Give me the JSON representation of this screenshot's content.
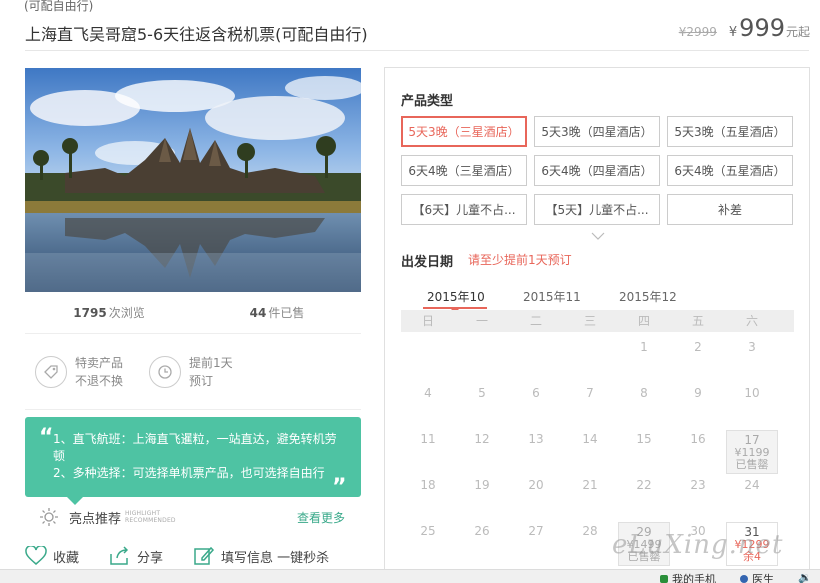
{
  "product": {
    "subtitle_cut": "(可配自由行)",
    "title": "上海直飞吴哥窟5-6天往返含税机票(可配自由行)",
    "original_price": "¥2999",
    "currency": "¥",
    "price": "999",
    "price_suffix": "元起"
  },
  "stats": {
    "views": "1795",
    "views_label": "次浏览",
    "sold": "44",
    "sold_label": "件已售"
  },
  "features": [
    {
      "icon": "tag-icon",
      "line1": "特卖产品",
      "line2": "不退不换"
    },
    {
      "icon": "clock-icon",
      "line1": "提前1天",
      "line2": "预订"
    }
  ],
  "highlights": {
    "quote_left": "“",
    "quote_right": "„",
    "text1": "1、直飞航班：上海直飞暹粒，一站直达，避免转机劳顿",
    "text2": "2、多种选择：可选择单机票产品，也可选择自由行",
    "label": "亮点推荐",
    "label_en1": "HIGHLIGHT",
    "label_en2": "RECOMMENDED",
    "more": "查看更多"
  },
  "actions": {
    "favorite": "收藏",
    "share": "分享",
    "quick_order": "填写信息 一键秒杀"
  },
  "product_type": {
    "title": "产品类型",
    "options": [
      "5天3晚（三星酒店）",
      "5天3晚（四星酒店）",
      "5天3晚（五星酒店）",
      "6天4晚（三星酒店）",
      "6天4晚（四星酒店）",
      "6天4晚（五星酒店）",
      "【6天】儿童不占...",
      "【5天】儿童不占...",
      "补差"
    ],
    "selected_index": 0
  },
  "departure": {
    "title": "出发日期",
    "notice": "请至少提前1天预订",
    "months": [
      "2015年10",
      "2015年11",
      "2015年12"
    ],
    "active_month": 0,
    "weekdays": [
      "日",
      "一",
      "二",
      "三",
      "四",
      "五",
      "六"
    ],
    "days": [
      {
        "d": "1",
        "col": 4,
        "row": 0
      },
      {
        "d": "2",
        "col": 5,
        "row": 0
      },
      {
        "d": "3",
        "col": 6,
        "row": 0
      },
      {
        "d": "4",
        "col": 0,
        "row": 1
      },
      {
        "d": "5",
        "col": 1,
        "row": 1
      },
      {
        "d": "6",
        "col": 2,
        "row": 1
      },
      {
        "d": "7",
        "col": 3,
        "row": 1
      },
      {
        "d": "8",
        "col": 4,
        "row": 1
      },
      {
        "d": "9",
        "col": 5,
        "row": 1
      },
      {
        "d": "10",
        "col": 6,
        "row": 1
      },
      {
        "d": "11",
        "col": 0,
        "row": 2
      },
      {
        "d": "12",
        "col": 1,
        "row": 2
      },
      {
        "d": "13",
        "col": 2,
        "row": 2
      },
      {
        "d": "14",
        "col": 3,
        "row": 2
      },
      {
        "d": "15",
        "col": 4,
        "row": 2
      },
      {
        "d": "16",
        "col": 5,
        "row": 2
      },
      {
        "d": "17",
        "col": 6,
        "row": 2,
        "state": "soldout",
        "price": "¥1199",
        "status": "已售罄"
      },
      {
        "d": "18",
        "col": 0,
        "row": 3
      },
      {
        "d": "19",
        "col": 1,
        "row": 3
      },
      {
        "d": "20",
        "col": 2,
        "row": 3
      },
      {
        "d": "21",
        "col": 3,
        "row": 3
      },
      {
        "d": "22",
        "col": 4,
        "row": 3
      },
      {
        "d": "23",
        "col": 5,
        "row": 3
      },
      {
        "d": "24",
        "col": 6,
        "row": 3
      },
      {
        "d": "25",
        "col": 0,
        "row": 4
      },
      {
        "d": "26",
        "col": 1,
        "row": 4
      },
      {
        "d": "27",
        "col": 2,
        "row": 4
      },
      {
        "d": "28",
        "col": 3,
        "row": 4
      },
      {
        "d": "29",
        "col": 4,
        "row": 4,
        "state": "soldout",
        "price": "¥1499",
        "status": "已售罄"
      },
      {
        "d": "30",
        "col": 5,
        "row": 4
      },
      {
        "d": "31",
        "col": 6,
        "row": 4,
        "state": "avail",
        "price": "¥1299",
        "status": "余4"
      }
    ]
  },
  "watermark": "eLuXing.net",
  "taskbar": {
    "item1": "我的手机",
    "item2": "医生",
    "item3": "",
    "color1": "#2a8f3a",
    "color2": "#3465b0"
  },
  "colors": {
    "accent": "#e8665a",
    "green": "#4ec3a3"
  }
}
